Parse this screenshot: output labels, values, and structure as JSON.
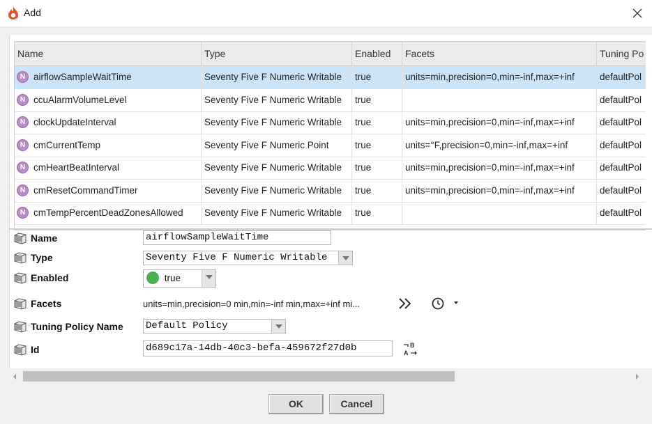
{
  "window": {
    "title": "Add",
    "app_icon": "niagara-flame-icon",
    "close_icon": "close-x-icon"
  },
  "table": {
    "columns": [
      "Name",
      "Type",
      "Enabled",
      "Facets",
      "Tuning Po"
    ],
    "rows": [
      {
        "name": "airflowSampleWaitTime",
        "type": "Seventy Five F Numeric Writable",
        "enabled": "true",
        "facets": "units=min,precision=0,min=-inf,max=+inf",
        "tuning": "defaultPol"
      },
      {
        "name": "ccuAlarmVolumeLevel",
        "type": "Seventy Five F Numeric Writable",
        "enabled": "true",
        "facets": "",
        "tuning": "defaultPol"
      },
      {
        "name": "clockUpdateInterval",
        "type": "Seventy Five F Numeric Writable",
        "enabled": "true",
        "facets": "units=min,precision=0,min=-inf,max=+inf",
        "tuning": "defaultPol"
      },
      {
        "name": "cmCurrentTemp",
        "type": "Seventy Five F Numeric Point",
        "enabled": "true",
        "facets": "units=°F,precision=0,min=-inf,max=+inf",
        "tuning": "defaultPol"
      },
      {
        "name": "cmHeartBeatInterval",
        "type": "Seventy Five F Numeric Writable",
        "enabled": "true",
        "facets": "units=min,precision=0,min=-inf,max=+inf",
        "tuning": "defaultPol"
      },
      {
        "name": "cmResetCommandTimer",
        "type": "Seventy Five F Numeric Writable",
        "enabled": "true",
        "facets": "units=min,precision=0,min=-inf,max=+inf",
        "tuning": "defaultPol"
      },
      {
        "name": "cmTempPercentDeadZonesAllowed",
        "type": "Seventy Five F Numeric Writable",
        "enabled": "true",
        "facets": "",
        "tuning": "defaultPol"
      }
    ],
    "row_icon_letter": "N",
    "selected_index": 0
  },
  "form": {
    "name": {
      "label": "Name",
      "value": "airflowSampleWaitTime"
    },
    "type": {
      "label": "Type",
      "value": "Seventy Five F Numeric Writable"
    },
    "enabled": {
      "label": "Enabled",
      "value": "true",
      "status_color": "#4caf50"
    },
    "facets": {
      "label": "Facets",
      "value": "units=min,precision=0 min,min=-inf min,max=+inf mi..."
    },
    "tuning": {
      "label": "Tuning Policy Name",
      "value": "Default Policy"
    },
    "id": {
      "label": "Id",
      "value": "d689c17a-14db-40c3-befa-459672f27d0b"
    }
  },
  "buttons": {
    "ok": "OK",
    "cancel": "Cancel"
  },
  "colors": {
    "selected_row": "#cce4f7",
    "header": "#ebebeb",
    "accent_purple": "#b98cc9"
  }
}
